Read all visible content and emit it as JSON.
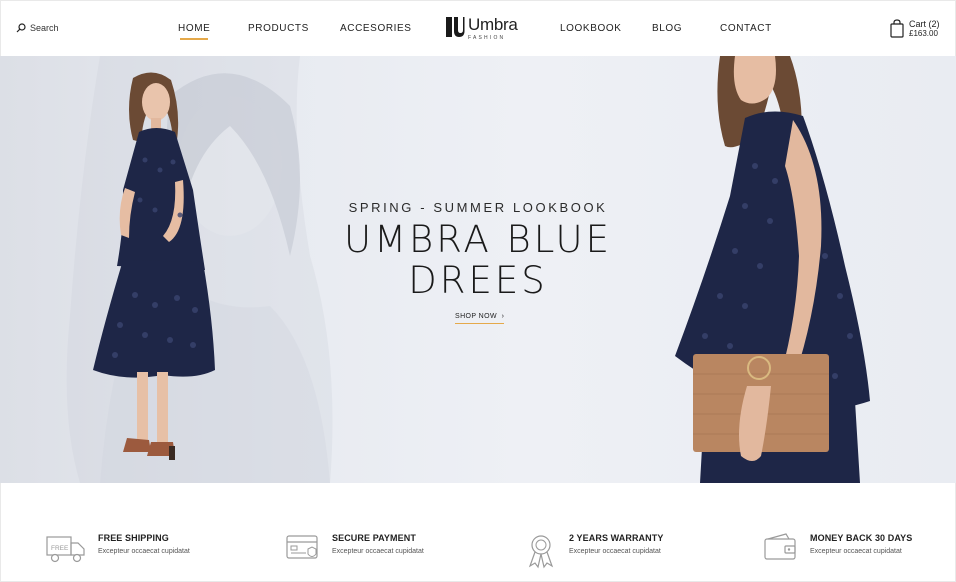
{
  "header": {
    "search_label": "Search",
    "nav": [
      "HOME",
      "PRODUCTS",
      "ACCESORIES",
      "LOOKBOOK",
      "BLOG",
      "CONTACT"
    ],
    "active_nav": "HOME",
    "logo_text": "Umbra",
    "logo_subtext": "FASHION",
    "cart_label": "Cart (2)",
    "cart_amount": "£163.00"
  },
  "hero": {
    "kicker": "SPRING - SUMMER LOOKBOOK",
    "title_line1": "UMBRA BLUE",
    "title_line2": "DREES",
    "cta": "SHOP NOW"
  },
  "features": [
    {
      "icon": "truck-icon",
      "title": "FREE SHIPPING",
      "desc": "Excepteur occaecat cupidatat"
    },
    {
      "icon": "credit-card-icon",
      "title": "SECURE PAYMENT",
      "desc": "Excepteur occaecat cupidatat"
    },
    {
      "icon": "award-ribbon-icon",
      "title": "2 YEARS WARRANTY",
      "desc": "Excepteur occaecat cupidatat"
    },
    {
      "icon": "wallet-icon",
      "title": "MONEY BACK 30 DAYS",
      "desc": "Excepteur occaecat cupidatat"
    }
  ],
  "colors": {
    "accent": "#e5a94a",
    "dress": "#1e2647",
    "hero_bg": "#e8ebf1"
  }
}
